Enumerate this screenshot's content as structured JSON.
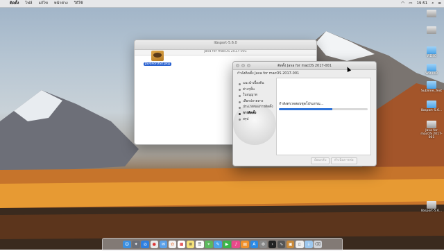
{
  "menubar": {
    "app": "ติดตั้ง",
    "items": [
      "ไฟล์",
      "แก้ไข",
      "หน้าต่าง",
      "วิธีใช้"
    ],
    "time": "19:51"
  },
  "finder": {
    "title": "libsport-5.6.0",
    "path": "Java for macOS 2017-001",
    "file_label": "JavaForOSX.pkg"
  },
  "installer": {
    "title": "ติดตั้ง Java for macOS 2017-001",
    "subtitle": "กำลังติดตั้ง Java for macOS 2017-001",
    "steps": [
      {
        "label": "แนะนำเบื้องต้น"
      },
      {
        "label": "ต่างๆนั้น"
      },
      {
        "label": "ใบอนุญาต"
      },
      {
        "label": "เลือกปลายทาง"
      },
      {
        "label": "ประเภทของการติดตั้ง"
      },
      {
        "label": "การติดตั้ง"
      },
      {
        "label": "สรุป"
      }
    ],
    "active_step": 5,
    "status_message": "กำลังตรวจสอบชุดโปรแกรม...",
    "progress": 0.6,
    "buttons": {
      "back": "ย้อนกลับ",
      "continue": "ดำเนินการต่อ"
    }
  },
  "desktop_icons": [
    {
      "label": "WD40"
    },
    {
      "label": "WD40D"
    },
    {
      "label": "Sublime_Text"
    },
    {
      "label": "libsport-5.6..."
    },
    {
      "label": "Java for macOS 2017-001"
    },
    {
      "label": "libsport-5.6..."
    }
  ],
  "dock_icons": [
    "finder-icon",
    "launchpad-icon",
    "safari-icon",
    "chrome-icon",
    "mail-icon",
    "photos-icon",
    "calendar-icon",
    "notes-icon",
    "reminders-icon",
    "maps-icon",
    "messages-icon",
    "facetime-icon",
    "itunes-icon",
    "ibooks-icon",
    "appstore-icon",
    "preferences-icon",
    "terminal-icon",
    "activity-icon",
    "installer-icon",
    "document-icon",
    "downloads-icon",
    "trash-icon"
  ]
}
